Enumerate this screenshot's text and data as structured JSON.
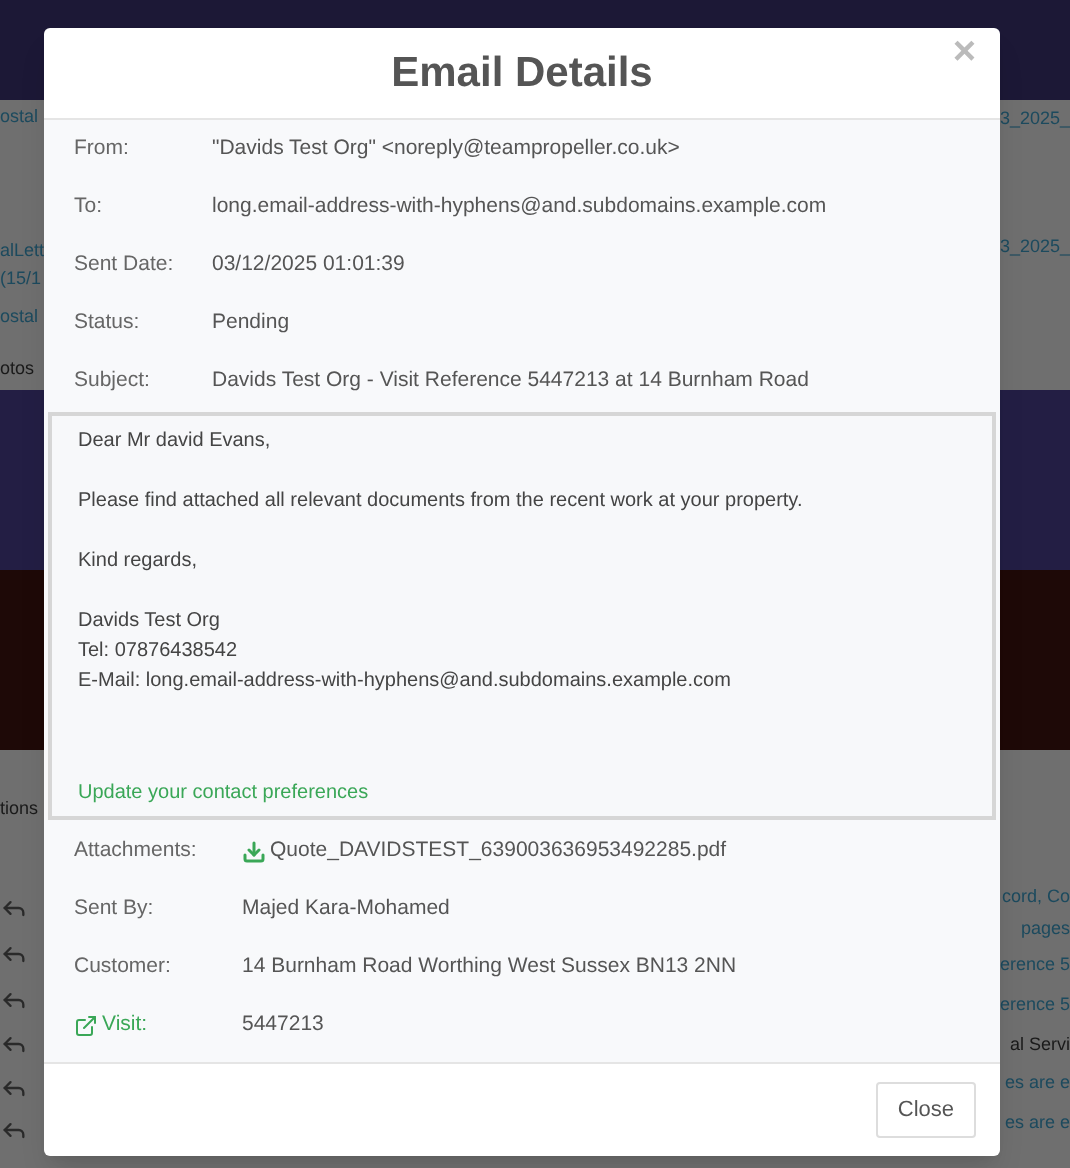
{
  "background": {
    "left_fragments": [
      {
        "text": "ostal",
        "kind": "link"
      },
      {
        "text": "alLett",
        "kind": "link"
      },
      {
        "text": "(15/1",
        "kind": "link"
      },
      {
        "text": "ostal",
        "kind": "link"
      },
      {
        "text": "otos",
        "kind": "text"
      },
      {
        "text": "tions",
        "kind": "text"
      }
    ],
    "right_fragments": [
      {
        "text": "3_2025_",
        "kind": "link"
      },
      {
        "text": "3_2025_",
        "kind": "link"
      },
      {
        "text": "cord, Co",
        "kind": "link"
      },
      {
        "text": "pages",
        "kind": "link"
      },
      {
        "text": "erence 5",
        "kind": "link"
      },
      {
        "text": "erence 5",
        "kind": "link"
      },
      {
        "text": "al Servi",
        "kind": "text"
      },
      {
        "text": "es are e",
        "kind": "link"
      },
      {
        "text": "es are e",
        "kind": "link"
      }
    ]
  },
  "modal": {
    "title": "Email Details",
    "close_symbol": "×",
    "fields": [
      {
        "label": "From:",
        "value": "\"Davids Test Org\" <noreply@teampropeller.co.uk>"
      },
      {
        "label": "To:",
        "value": "long.email-address-with-hyphens@and.subdomains.example.com"
      },
      {
        "label": "Sent Date:",
        "value": "03/12/2025 01:01:39"
      },
      {
        "label": "Status:",
        "value": "Pending"
      },
      {
        "label": "Subject:",
        "value": "Davids Test Org - Visit Reference 5447213 at 14 Burnham Road"
      }
    ],
    "email_body": {
      "paragraphs": [
        [
          "Dear Mr david Evans,"
        ],
        [
          "Please find attached all relevant documents from the recent work at your property."
        ],
        [
          "Kind regards,"
        ],
        [
          "Davids Test Org",
          "Tel: 07876438542",
          "E-Mail: long.email-address-with-hyphens@and.subdomains.example.com"
        ]
      ],
      "link": "Update your contact preferences"
    },
    "details": [
      {
        "label": "Attachments:",
        "value": "Quote_DAVIDSTEST_639003636953492285.pdf",
        "kind": "attachment"
      },
      {
        "label": "Sent By:",
        "value": "Majed Kara-Mohamed",
        "kind": "text"
      },
      {
        "label": "Customer:",
        "value": "14 Burnham Road Worthing West Sussex BN13 2NN",
        "kind": "text"
      },
      {
        "label": "Visit:",
        "value": "5447213",
        "kind": "visit"
      }
    ],
    "buttons": [
      "Close"
    ]
  }
}
